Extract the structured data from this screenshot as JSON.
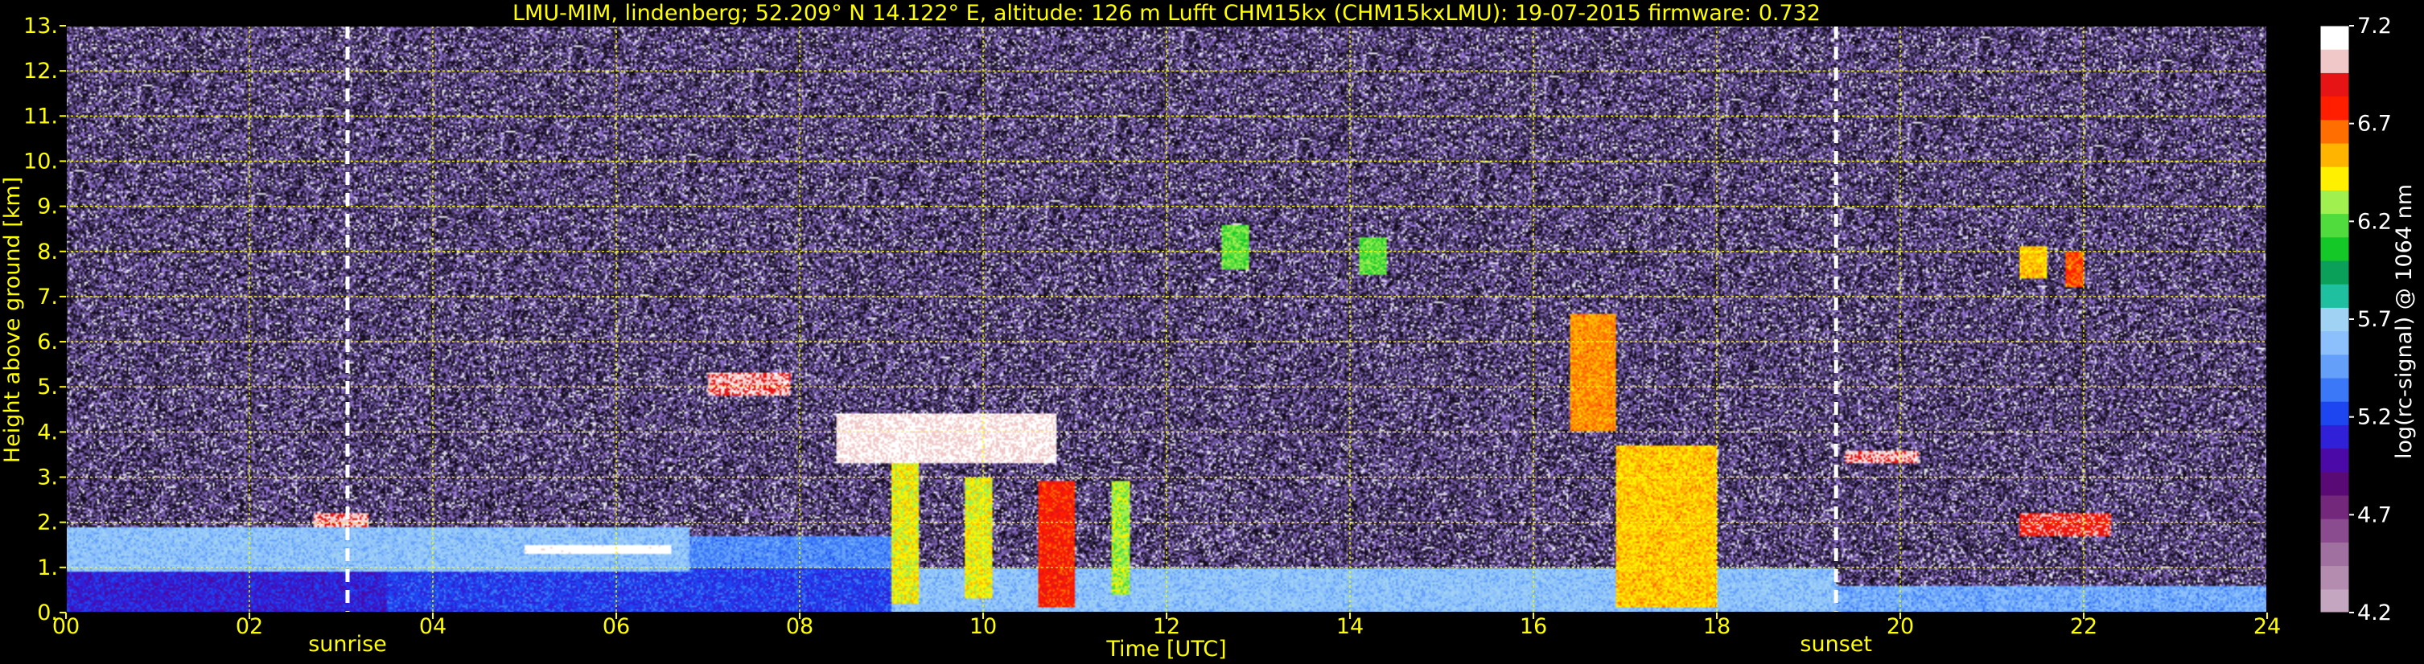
{
  "chart_data": {
    "type": "heatmap",
    "title": "LMU-MIM, lindenberg; 52.209° N 14.122° E, altitude: 126 m    Lufft CHM15kx (CHM15kxLMU): 19-07-2015    firmware: 0.732",
    "xlabel": "Time [UTC]",
    "ylabel": "Height above ground [km]",
    "xlim": [
      0,
      24
    ],
    "ylim": [
      0,
      13
    ],
    "x_ticks": [
      "00",
      "02",
      "04",
      "06",
      "08",
      "10",
      "12",
      "14",
      "16",
      "18",
      "20",
      "22",
      "24"
    ],
    "y_ticks": [
      "0.",
      "1.",
      "2.",
      "3.",
      "4.",
      "5.",
      "6.",
      "7.",
      "8.",
      "9.",
      "10.",
      "11.",
      "12.",
      "13."
    ],
    "grid": true,
    "grid_color": "#ffff00",
    "annotations": [
      {
        "label": "sunrise",
        "x": 3.07
      },
      {
        "label": "sunset",
        "x": 19.3
      }
    ],
    "colorbar": {
      "label": "log(rc-signal) @ 1064 nm",
      "range": [
        4.2,
        7.2
      ],
      "ticks": [
        "4.2",
        "4.7",
        "5.2",
        "5.7",
        "6.2",
        "6.7",
        "7.2"
      ],
      "colors": [
        "#c4a6c0",
        "#b48cb0",
        "#a070a0",
        "#8a4c8e",
        "#74287c",
        "#5a0a74",
        "#4b0aa8",
        "#3020d8",
        "#1e46f0",
        "#3a78f8",
        "#64a0fa",
        "#8cc0fc",
        "#a0d2f4",
        "#1ec0a0",
        "#0aa05a",
        "#14c828",
        "#50dc3c",
        "#a0f050",
        "#fff000",
        "#ffb400",
        "#ff6e00",
        "#ff1e00",
        "#e61414",
        "#f0c8c8",
        "#ffffff"
      ]
    },
    "layers": [
      {
        "name": "noise",
        "t0": 0,
        "t1": 24,
        "h0": 0,
        "h1": 13,
        "value": 4.9
      },
      {
        "name": "boundary-layer-base",
        "t0": 0,
        "t1": 3.5,
        "h0": 0,
        "h1": 0.9,
        "value": 5.1
      },
      {
        "name": "boundary-layer-base",
        "t0": 3.5,
        "t1": 9,
        "h0": 0,
        "h1": 1.0,
        "value": 5.2
      },
      {
        "name": "boundary-layer-base",
        "t0": 9,
        "t1": 19.3,
        "h0": 0,
        "h1": 1.0,
        "value": 5.6
      },
      {
        "name": "boundary-layer-base",
        "t0": 19.3,
        "t1": 24,
        "h0": 0,
        "h1": 0.6,
        "value": 5.5
      },
      {
        "name": "residual-layer",
        "t0": 0,
        "t1": 6.8,
        "h0": 0.9,
        "h1": 1.9,
        "value": 5.6
      },
      {
        "name": "residual-layer",
        "t0": 6.8,
        "t1": 9,
        "h0": 1.0,
        "h1": 1.7,
        "value": 5.4
      },
      {
        "name": "residual-layer",
        "t0": 19.3,
        "t1": 24,
        "h0": 0.6,
        "h1": 1.7,
        "value": 4.8
      },
      {
        "name": "low-cloud",
        "t0": 5.0,
        "t1": 6.6,
        "h0": 1.3,
        "h1": 1.5,
        "value": 7.2
      },
      {
        "name": "low-cloud",
        "t0": 2.7,
        "t1": 3.3,
        "h0": 1.9,
        "h1": 2.2,
        "value": 7.0
      },
      {
        "name": "cumulus",
        "t0": 10.6,
        "t1": 11.0,
        "h0": 0.1,
        "h1": 2.9,
        "value": 6.8
      },
      {
        "name": "cumulus",
        "t0": 16.9,
        "t1": 18.0,
        "h0": 0.1,
        "h1": 3.7,
        "value": 6.5
      },
      {
        "name": "cumulus",
        "t0": 9.0,
        "t1": 9.3,
        "h0": 0.2,
        "h1": 3.3,
        "value": 6.4
      },
      {
        "name": "cumulus",
        "t0": 9.8,
        "t1": 10.1,
        "h0": 0.3,
        "h1": 3.0,
        "value": 6.4
      },
      {
        "name": "cumulus",
        "t0": 11.4,
        "t1": 11.6,
        "h0": 0.4,
        "h1": 2.9,
        "value": 6.3
      },
      {
        "name": "cloud-top-edge",
        "t0": 8.4,
        "t1": 10.8,
        "h0": 3.3,
        "h1": 4.4,
        "value": 7.1
      },
      {
        "name": "elevated-layer",
        "t0": 7.0,
        "t1": 7.9,
        "h0": 4.8,
        "h1": 5.3,
        "value": 7.0
      },
      {
        "name": "convective-plume",
        "t0": 16.4,
        "t1": 16.9,
        "h0": 4.0,
        "h1": 6.6,
        "value": 6.6
      },
      {
        "name": "cirrus",
        "t0": 12.6,
        "t1": 12.9,
        "h0": 7.6,
        "h1": 8.6,
        "value": 6.2
      },
      {
        "name": "cirrus",
        "t0": 14.1,
        "t1": 14.4,
        "h0": 7.5,
        "h1": 8.3,
        "value": 6.2
      },
      {
        "name": "cirrus",
        "t0": 21.3,
        "t1": 21.6,
        "h0": 7.4,
        "h1": 8.1,
        "value": 6.5
      },
      {
        "name": "cirrus",
        "t0": 21.8,
        "t1": 22.0,
        "h0": 7.2,
        "h1": 8.0,
        "value": 6.7
      },
      {
        "name": "evening-layer",
        "t0": 19.4,
        "t1": 20.2,
        "h0": 3.3,
        "h1": 3.6,
        "value": 7.0
      },
      {
        "name": "evening-layer",
        "t0": 21.3,
        "t1": 22.3,
        "h0": 1.7,
        "h1": 2.2,
        "value": 6.9
      }
    ]
  }
}
